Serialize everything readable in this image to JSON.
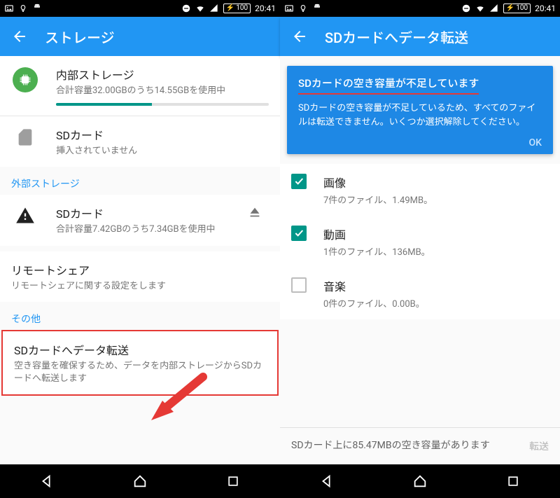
{
  "status": {
    "time": "20:41",
    "battery": "100"
  },
  "left": {
    "title": "ストレージ",
    "internal": {
      "title": "内部ストレージ",
      "sub": "合計容量32.00GBのうち14.55GBを使用中"
    },
    "sd_none": {
      "title": "SDカード",
      "sub": "挿入されていません"
    },
    "section_external": "外部ストレージ",
    "sd_ext": {
      "title": "SDカード",
      "sub": "合計容量7.42GBのうち7.34GBを使用中"
    },
    "remote": {
      "title": "リモートシェア",
      "sub": "リモートシェアに関する設定をします"
    },
    "section_other": "その他",
    "transfer": {
      "title": "SDカードへデータ転送",
      "sub": "空き容量を確保するため、データを内部ストレージからSDカードへ転送します"
    }
  },
  "right": {
    "title": "SDカードへデータ転送",
    "banner": {
      "title": "SDカードの空き容量が不足しています",
      "msg": "SDカードの空き容量が不足しているため、すべてのファイルは転送できません。いくつか選択解除してください。",
      "ok": "OK"
    },
    "items": [
      {
        "label": "画像",
        "sub": "7件のファイル、1.49MB。",
        "checked": true
      },
      {
        "label": "動画",
        "sub": "1件のファイル、136MB。",
        "checked": true
      },
      {
        "label": "音楽",
        "sub": "0件のファイル、0.00B。",
        "checked": false
      }
    ],
    "footer": {
      "text": "SDカード上に85.47MBの空き容量があります",
      "btn": "転送"
    }
  }
}
